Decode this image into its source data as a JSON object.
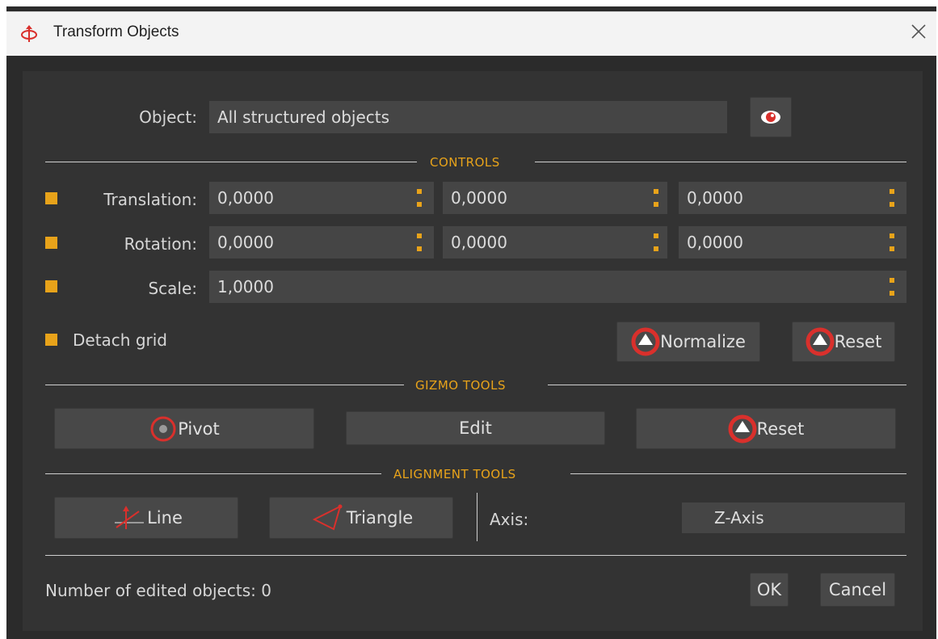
{
  "window": {
    "title": "Transform Objects",
    "title_icon": "transform-icon",
    "close_icon": "close-icon"
  },
  "object": {
    "label": "Object:",
    "value": "All structured objects",
    "eye_icon": "eye-icon"
  },
  "sections": {
    "controls": "CONTROLS",
    "gizmo": "GIZMO TOOLS",
    "alignment": "ALIGNMENT TOOLS"
  },
  "translation": {
    "label": "Translation:",
    "x": "0,0000",
    "y": "0,0000",
    "z": "0,0000"
  },
  "rotation": {
    "label": "Rotation:",
    "x": "0,0000",
    "y": "0,0000",
    "z": "0,0000"
  },
  "scale": {
    "label": "Scale:",
    "value": "1,0000"
  },
  "detach": {
    "label": "Detach grid"
  },
  "controls_buttons": {
    "normalize": "Normalize",
    "reset": "Reset"
  },
  "gizmo_buttons": {
    "pivot": "Pivot",
    "edit": "Edit",
    "reset": "Reset"
  },
  "alignment": {
    "line": "Line",
    "triangle": "Triangle",
    "axis_label": "Axis:",
    "axis_value": "Z-Axis"
  },
  "footer": {
    "edited_label": "Number of edited objects: 0",
    "ok": "OK",
    "cancel": "Cancel"
  },
  "colors": {
    "accent": "#e8a31a",
    "background": "#333333",
    "field": "#454545",
    "icon_red": "#d9302c"
  }
}
